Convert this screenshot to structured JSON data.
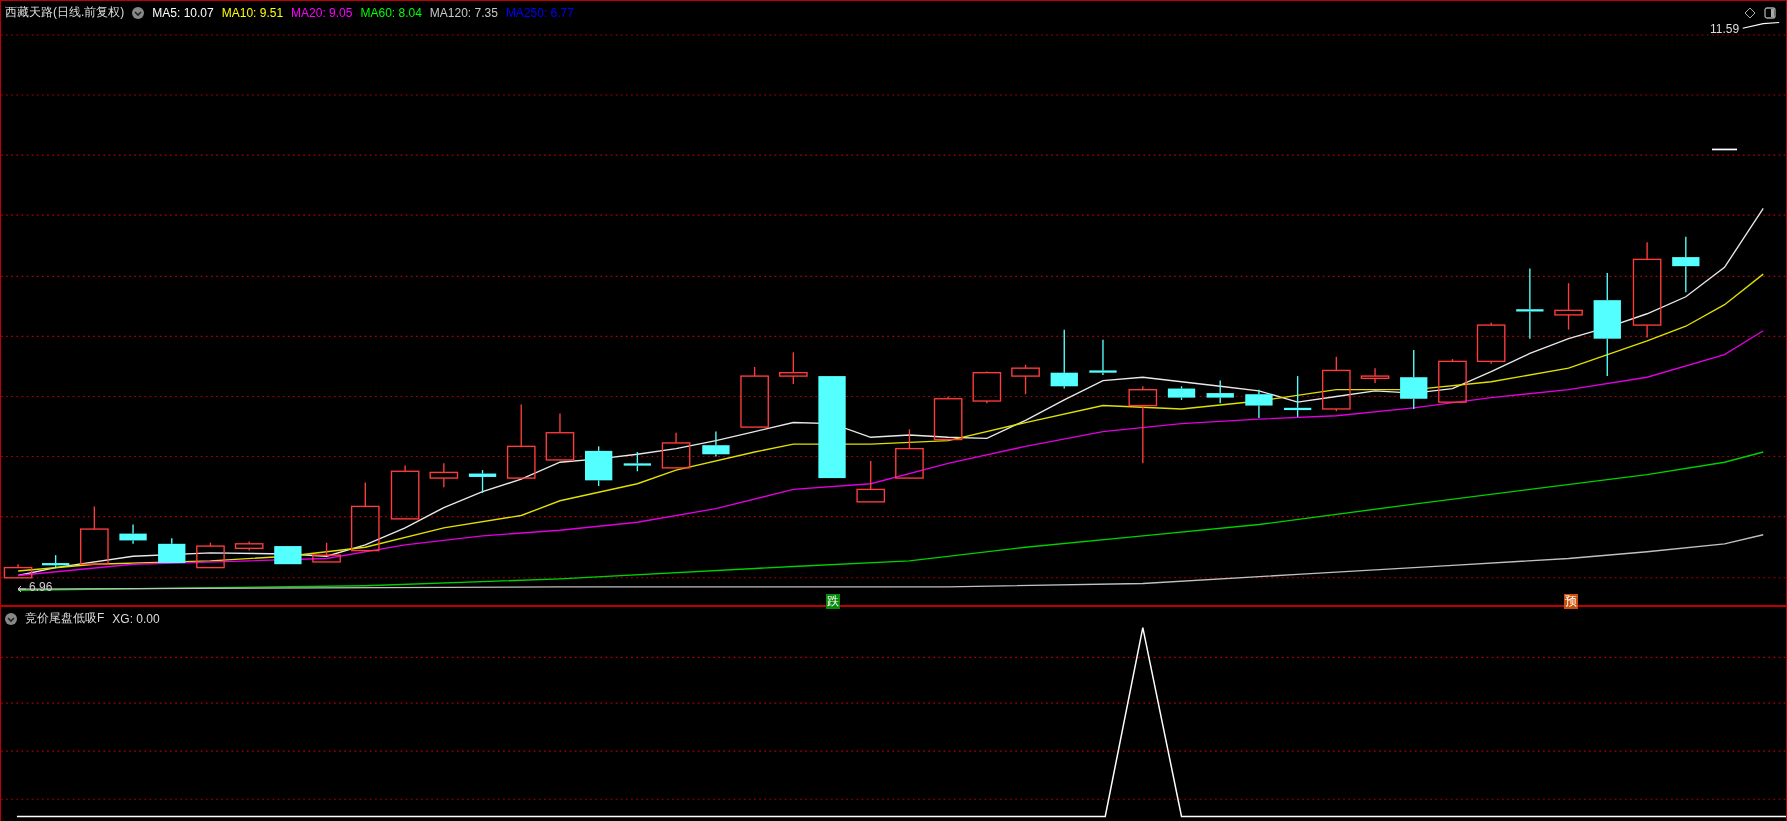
{
  "title": "西藏天路(日线.前复权)",
  "moving_averages": [
    {
      "label": "MA5: 10.07",
      "color": "#ffffff"
    },
    {
      "label": "MA10: 9.51",
      "color": "#ffff00"
    },
    {
      "label": "MA20: 9.05",
      "color": "#ff00ff"
    },
    {
      "label": "MA60: 8.04",
      "color": "#00ff00"
    },
    {
      "label": "MA120: 7.35",
      "color": "#c8c8c8"
    },
    {
      "label": "MA250: 6.77",
      "color": "#0000ff"
    }
  ],
  "high_label": "11.59",
  "low_label": "6.96",
  "signals": [
    {
      "text": "跌",
      "kind": "fall"
    },
    {
      "text": "预",
      "kind": "pre"
    }
  ],
  "indicator": {
    "name": "竞价尾盘低吸F",
    "reading": "XG: 0.00"
  }
}
